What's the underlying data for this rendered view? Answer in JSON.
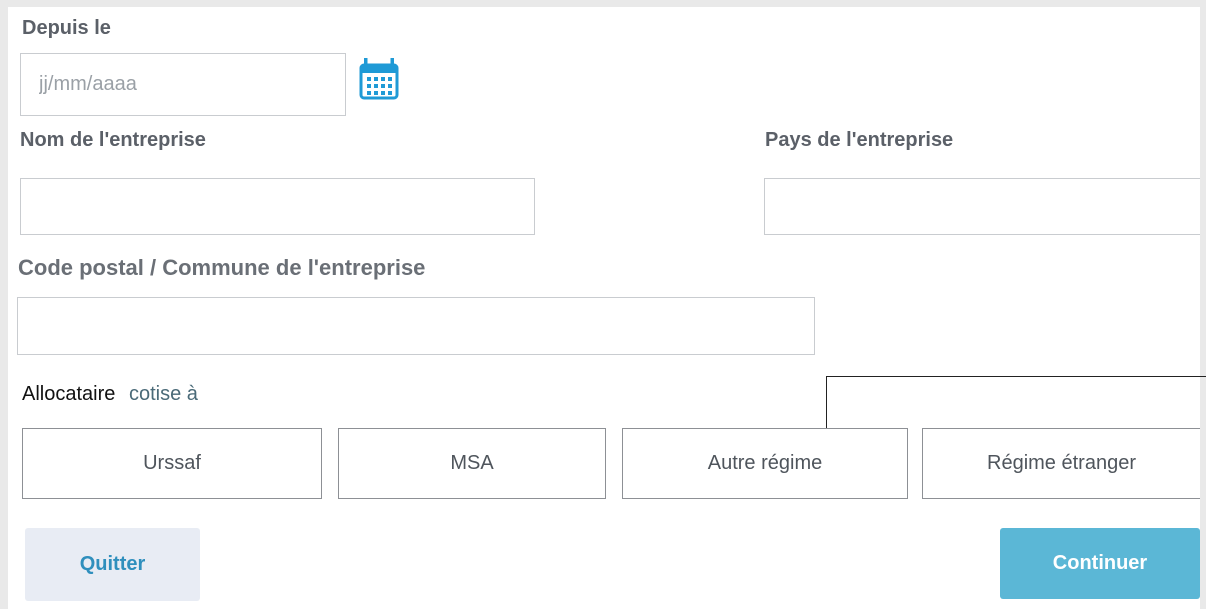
{
  "form": {
    "depuis_label": "Depuis le",
    "date_placeholder": "jj/mm/aaaa",
    "nom_label": "Nom de l'entreprise",
    "pays_label": "Pays de l'entreprise",
    "code_label": "Code postal / Commune de l'entreprise",
    "allocataire_label": "Allocataire",
    "cotise_label": "cotise à"
  },
  "choices": [
    "Urssaf",
    "MSA",
    "Autre régime",
    "Régime étranger"
  ],
  "buttons": {
    "quitter": "Quitter",
    "continuer": "Continuer"
  },
  "icons": {
    "date_picker": "calendar-icon"
  },
  "colors": {
    "accent": "#2f8fbd",
    "primary_button": "#5bb7d6",
    "secondary_button": "#e8ecf4",
    "icon": "#1f9ad6"
  }
}
